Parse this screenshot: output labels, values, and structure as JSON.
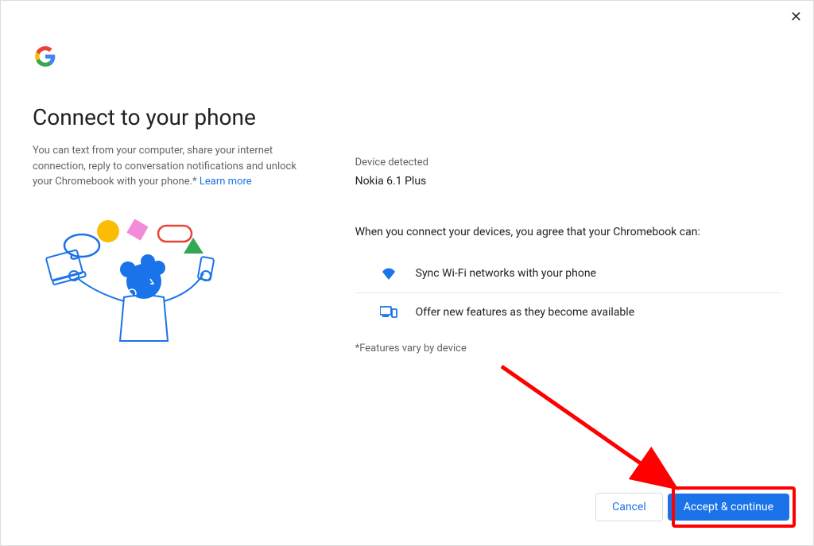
{
  "header": {
    "close_aria": "Close"
  },
  "left": {
    "title": "Connect to your phone",
    "description_prefix": "You can text from your computer, share your internet connection, reply to conversation notifications and unlock your Chromebook with your phone.* ",
    "learn_more": "Learn more"
  },
  "right": {
    "device_detected_label": "Device detected",
    "device_name": "Nokia 6.1 Plus",
    "agreement_text": "When you connect your devices, you agree that your Chromebook can:",
    "features": [
      {
        "icon": "wifi-icon",
        "label": "Sync Wi-Fi networks with your phone"
      },
      {
        "icon": "devices-icon",
        "label": "Offer new features as they become available"
      }
    ],
    "footnote": "*Features vary by device"
  },
  "footer": {
    "cancel": "Cancel",
    "accept": "Accept & continue"
  }
}
